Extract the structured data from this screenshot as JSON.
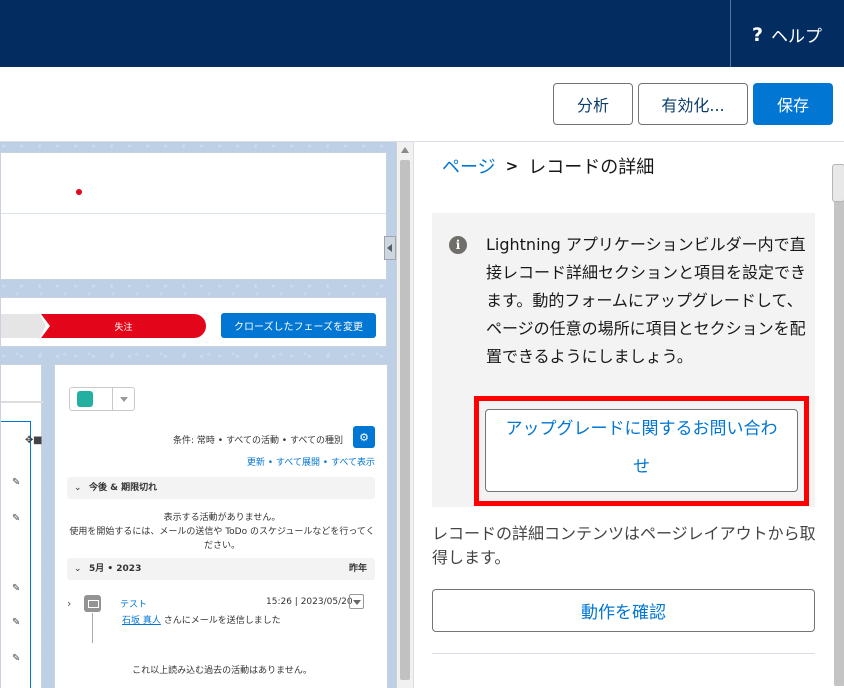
{
  "header": {
    "help_label": "ヘルプ",
    "help_icon": "?"
  },
  "toolbar": {
    "analyze_label": "分析",
    "activate_label": "有効化...",
    "save_label": "保存"
  },
  "canvas": {
    "path": {
      "current_stage": "失注",
      "change_button": "クローズしたフェーズを変更"
    },
    "activity": {
      "filter_text": "条件: 常時 • すべての活動 • すべての種別",
      "links": "更新 • すべて展開 • すべて表示",
      "upcoming_section": "今後 & 期限切れ",
      "empty_message_1": "表示する活動がありません。",
      "empty_message_2": "使用を開始するには、メールの送信や ToDo のスケジュールなどを行ってください。",
      "month_section": "5月 • 2023",
      "month_right": "昨年",
      "item_title": "テスト",
      "item_date": "15:26 | 2023/05/20",
      "item_who": "石坂 真人",
      "item_action": " さんにメールを送信しました",
      "no_more": "これ以上読み込む過去の活動はありません。"
    }
  },
  "panel": {
    "breadcrumb_parent": "ページ",
    "breadcrumb_separator": ">",
    "breadcrumb_current": "レコードの詳細",
    "info_text": "Lightning アプリケーションビルダー内で直接レコード詳細セクションと項目を設定できます。動的フォームにアップグレードして、ページの任意の場所に項目とセクションを配置できるようにしましょう。",
    "upgrade_button": "アップグレードに関するお問い合わせ",
    "description": "レコードの詳細コンテンツはページレイアウトから取得します。",
    "confirm_button": "動作を確認"
  },
  "colors": {
    "nav_bg": "#032d60",
    "brand_blue": "#0176d3",
    "highlight_red": "#ff0000",
    "path_red": "#e3061a"
  }
}
